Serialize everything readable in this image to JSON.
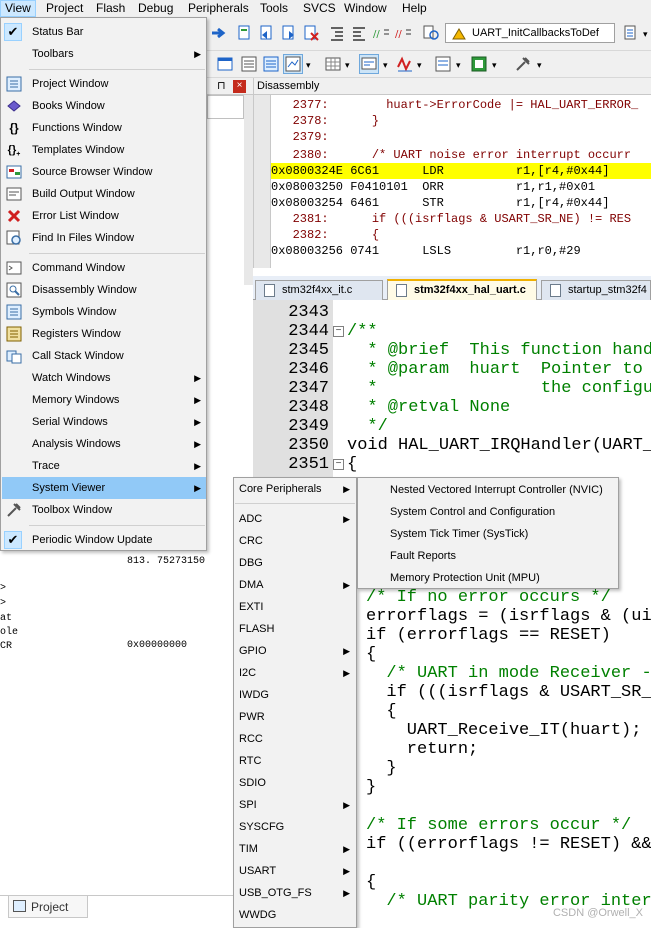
{
  "menubar": [
    "View",
    "Project",
    "Flash",
    "Debug",
    "Peripherals",
    "Tools",
    "SVCS",
    "Window",
    "Help"
  ],
  "toolbar": {
    "function_combo": "UART_InitCallbacksToDef"
  },
  "left_panel": {
    "rows": [
      "813. 75273150",
      "0x00000000"
    ],
    "fragments": [
      ">",
      ">",
      "at",
      "ole",
      "CR"
    ],
    "bottom_tab": "Project"
  },
  "disassembly": {
    "title": "Disassembly",
    "lines": [
      "   2377:        huart->ErrorCode |= HAL_UART_ERROR_",
      "   2378:      }",
      "   2379:",
      "   2380:      /* UART noise error interrupt occurr",
      "0x0800324E 6C61      LDR          r1,[r4,#0x44]",
      "0x08003250 F0410101  ORR          r1,r1,#0x01",
      "0x08003254 6461      STR          r1,[r4,#0x44]",
      "   2381:      if (((isrflags & USART_SR_NE) != RES",
      "   2382:      {",
      "0x08003256 0741      LSLS         r1,r0,#29"
    ]
  },
  "editor": {
    "tabs": [
      "stm32f4xx_it.c",
      "stm32f4xx_hal_uart.c",
      "startup_stm32f4"
    ],
    "line_numbers": [
      "2343",
      "2344",
      "2345",
      "2346",
      "2347",
      "2348",
      "2349",
      "2350",
      "2351"
    ],
    "code_top": [
      "",
      "/**",
      "  * @brief  This function handl",
      "  * @param  huart  Pointer to a",
      "  *                the configu",
      "  * @retval None",
      "  */",
      "void HAL_UART_IRQHandler(UART_H",
      "{"
    ],
    "code_bottom": [
      "/* If no error occurs */",
      "errorflags = (isrflags & (uin",
      "if (errorflags == RESET)",
      "{",
      "  /* UART in mode Receiver --",
      "  if (((isrflags & USART_SR_R",
      "  {",
      "    UART_Receive_IT(huart);",
      "    return;",
      "  }",
      "}",
      "",
      "/* If some errors occur */",
      "if ((errorflags != RESET) &&",
      "",
      "{",
      "  /* UART parity error intern"
    ],
    "watermark": "CSDN @Orwell_X"
  },
  "view_menu": [
    {
      "label": "Status Bar",
      "checked": true
    },
    {
      "label": "Toolbars",
      "submenu": true
    },
    {
      "label": "Project Window"
    },
    {
      "label": "Books Window"
    },
    {
      "label": "Functions Window"
    },
    {
      "label": "Templates Window"
    },
    {
      "label": "Source Browser Window"
    },
    {
      "label": "Build Output Window"
    },
    {
      "label": "Error List Window"
    },
    {
      "label": "Find In Files Window"
    },
    {
      "label": "Command Window"
    },
    {
      "label": "Disassembly Window"
    },
    {
      "label": "Symbols Window"
    },
    {
      "label": "Registers Window"
    },
    {
      "label": "Call Stack Window"
    },
    {
      "label": "Watch Windows",
      "submenu": true
    },
    {
      "label": "Memory Windows",
      "submenu": true
    },
    {
      "label": "Serial Windows",
      "submenu": true
    },
    {
      "label": "Analysis Windows",
      "submenu": true
    },
    {
      "label": "Trace",
      "submenu": true
    },
    {
      "label": "System Viewer",
      "submenu": true,
      "highlighted": true
    },
    {
      "label": "Toolbox Window"
    },
    {
      "label": "Periodic Window Update",
      "checked": true
    }
  ],
  "system_viewer_menu": [
    "Core Peripherals",
    "ADC",
    "CRC",
    "DBG",
    "DMA",
    "EXTI",
    "FLASH",
    "GPIO",
    "I2C",
    "IWDG",
    "PWR",
    "RCC",
    "RTC",
    "SDIO",
    "SPI",
    "SYSCFG",
    "TIM",
    "USART",
    "USB_OTG_FS",
    "WWDG"
  ],
  "core_peripherals_menu": [
    "Nested Vectored Interrupt Controller (NVIC)",
    "System Control and Configuration",
    "System Tick Timer (SysTick)",
    "Fault Reports",
    "Memory Protection Unit (MPU)"
  ]
}
